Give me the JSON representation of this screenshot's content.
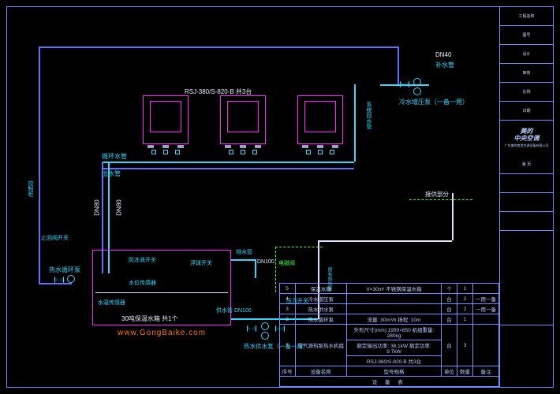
{
  "meta": {
    "domain": "Diagram",
    "drawing_type": "空调/热水系统原理图 (HVAC/Hot-water system schematic)"
  },
  "titleblock": {
    "brand": "美的\n中央空调",
    "sub": "广东美的商用空调设备有限公司",
    "rows": [
      "工程名称",
      "图号",
      "设计",
      "审核",
      "比例",
      "日期",
      "第 页"
    ]
  },
  "watermark": "www.GongBaike.com",
  "labels": {
    "units_header": "RSJ-380/S-820-B   共3台",
    "dn40": "DN40",
    "dn80a": "DN80",
    "dn80b": "DN80",
    "dn100": "DN100",
    "fill_pipe": "补水管",
    "cold_fill_pump": "冷水增压泵（一备一用）",
    "system_return": "系统回水管",
    "loop_pipe": "循环水管",
    "out_pipe": "出水管",
    "bleed_valve": "止回阀开关",
    "control_box": "控制柜",
    "tank_caption": "30吨保温水箱   共1个",
    "sensor": "水温传感器",
    "floatswitch": "浮球开关",
    "levelctl": "水位传感器",
    "antifouling": "防冻液开关",
    "drain_pipe": "排水管",
    "solenoid": "电磁阀",
    "pressure_sw": "压力开关",
    "supply_dn": "供水管 DN100",
    "hot_supply_pump": "热水供水泵（一备一用）",
    "pump_loop": "热水循环泵",
    "gov_section": "接供部分",
    "inlet_line": "原有热水管"
  },
  "bom": {
    "header": [
      "序号",
      "设备名称",
      "型号规格",
      "单位",
      "数量",
      "备注"
    ],
    "rows": [
      {
        "no": "5",
        "name": "保温水箱",
        "spec": "V=30m³ 不锈钢保温水箱",
        "unit": "个",
        "qty": "1",
        "remark": ""
      },
      {
        "no": "4",
        "name": "冷水增压泵",
        "spec": "",
        "unit": "台",
        "qty": "2",
        "remark": "一用一备"
      },
      {
        "no": "3",
        "name": "热水供水泵",
        "spec": "",
        "unit": "台",
        "qty": "2",
        "remark": "一用一备"
      },
      {
        "no": "2",
        "name": "热水循环泵",
        "spec": "流量: 30m³/h 扬程: 10m",
        "unit": "台",
        "qty": "1",
        "remark": ""
      },
      {
        "no": "",
        "name": "",
        "spec": "外形尺寸(mm):1950×850 机组重量: 280kg",
        "unit": "",
        "qty": "",
        "remark": ""
      },
      {
        "no": "",
        "name": "",
        "spec": "额定输出功率: 38.1kW  额定功率: 9.7kW",
        "unit": "",
        "qty": "",
        "remark": ""
      },
      {
        "no": "1",
        "name": "空气源热泵热水机组",
        "spec": "RSJ-380/S-820-B 共3台",
        "unit": "台",
        "qty": "3",
        "remark": ""
      },
      {
        "no": "序号",
        "name": "设备名称",
        "spec": "型号规格",
        "unit": "单位",
        "qty": "数量",
        "remark": "备注"
      }
    ],
    "footer_title": "设 备 表"
  }
}
